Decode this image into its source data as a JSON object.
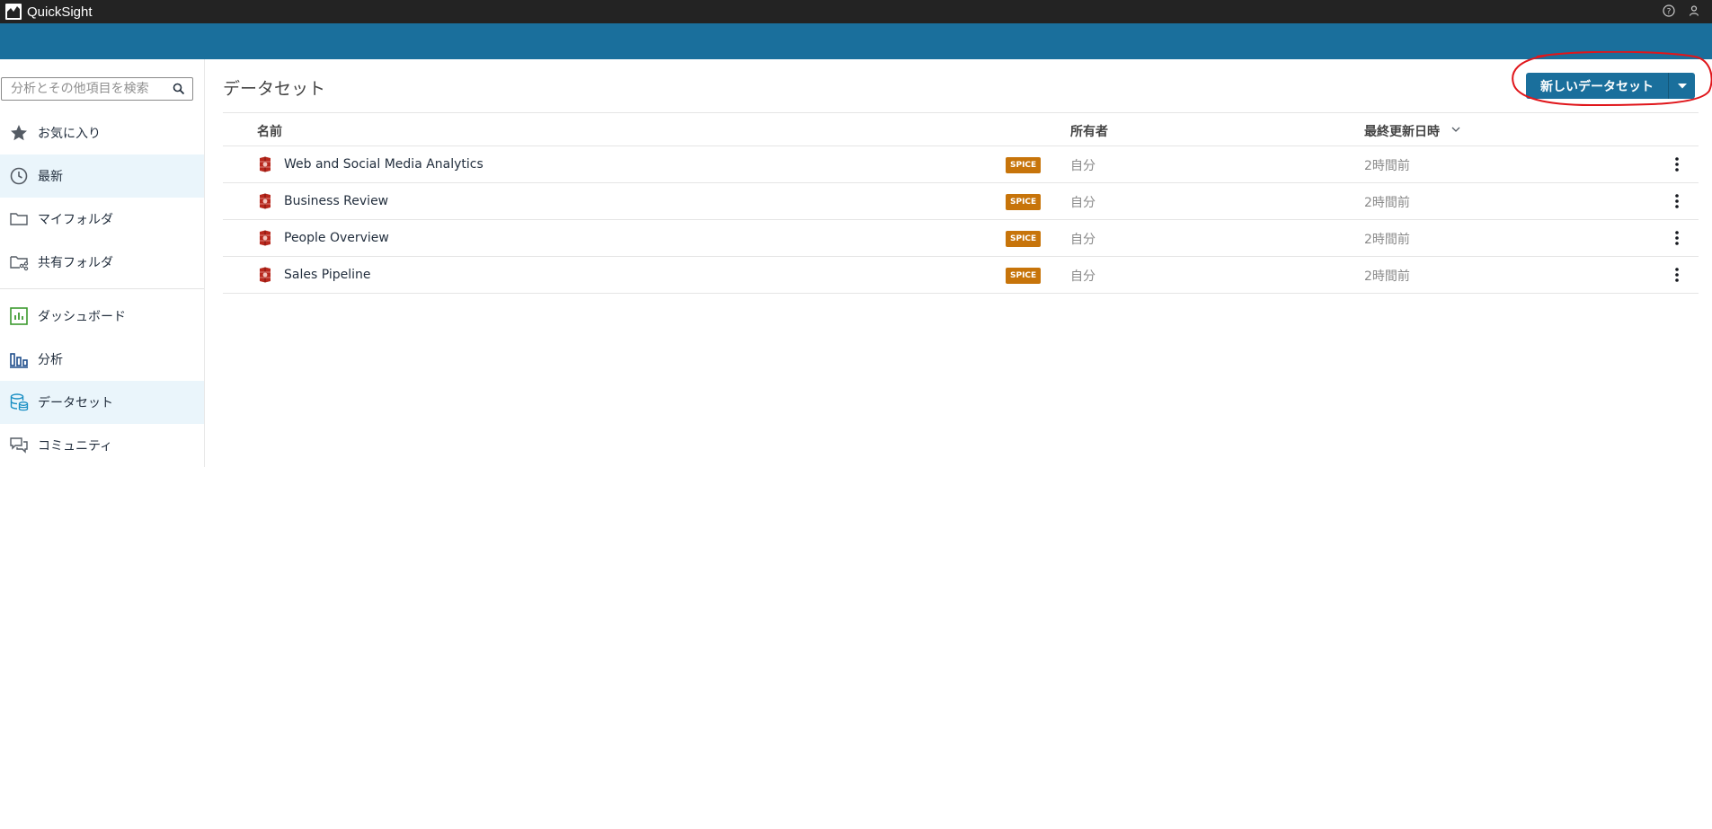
{
  "app": {
    "title": "QuickSight"
  },
  "sidebar": {
    "search_placeholder": "分析とその他項目を検索",
    "items": [
      {
        "label": "お気に入り",
        "icon": "star-icon"
      },
      {
        "label": "最新",
        "icon": "clock-icon",
        "active": true
      },
      {
        "label": "マイフォルダ",
        "icon": "folder-icon"
      },
      {
        "label": "共有フォルダ",
        "icon": "shared-folder-icon"
      },
      {
        "label": "ダッシュボード",
        "icon": "dashboard-icon"
      },
      {
        "label": "分析",
        "icon": "analysis-icon"
      },
      {
        "label": "データセット",
        "icon": "dataset-icon",
        "active": true
      },
      {
        "label": "コミュニティ",
        "icon": "community-icon"
      }
    ]
  },
  "main": {
    "title": "データセット",
    "new_button_label": "新しいデータセット",
    "columns": {
      "name": "名前",
      "owner": "所有者",
      "updated": "最終更新日時"
    },
    "rows": [
      {
        "name": "Web and Social Media Analytics",
        "badge": "SPICE",
        "owner": "自分",
        "updated": "2時間前"
      },
      {
        "name": "Business Review",
        "badge": "SPICE",
        "owner": "自分",
        "updated": "2時間前"
      },
      {
        "name": "People Overview",
        "badge": "SPICE",
        "owner": "自分",
        "updated": "2時間前"
      },
      {
        "name": "Sales Pipeline",
        "badge": "SPICE",
        "owner": "自分",
        "updated": "2時間前"
      }
    ]
  },
  "colors": {
    "topbar": "#232323",
    "brand_blue": "#1a6f9c",
    "spice_badge": "#c7740a",
    "active_nav": "#eaf5fb",
    "annotation": "#e0161b"
  }
}
